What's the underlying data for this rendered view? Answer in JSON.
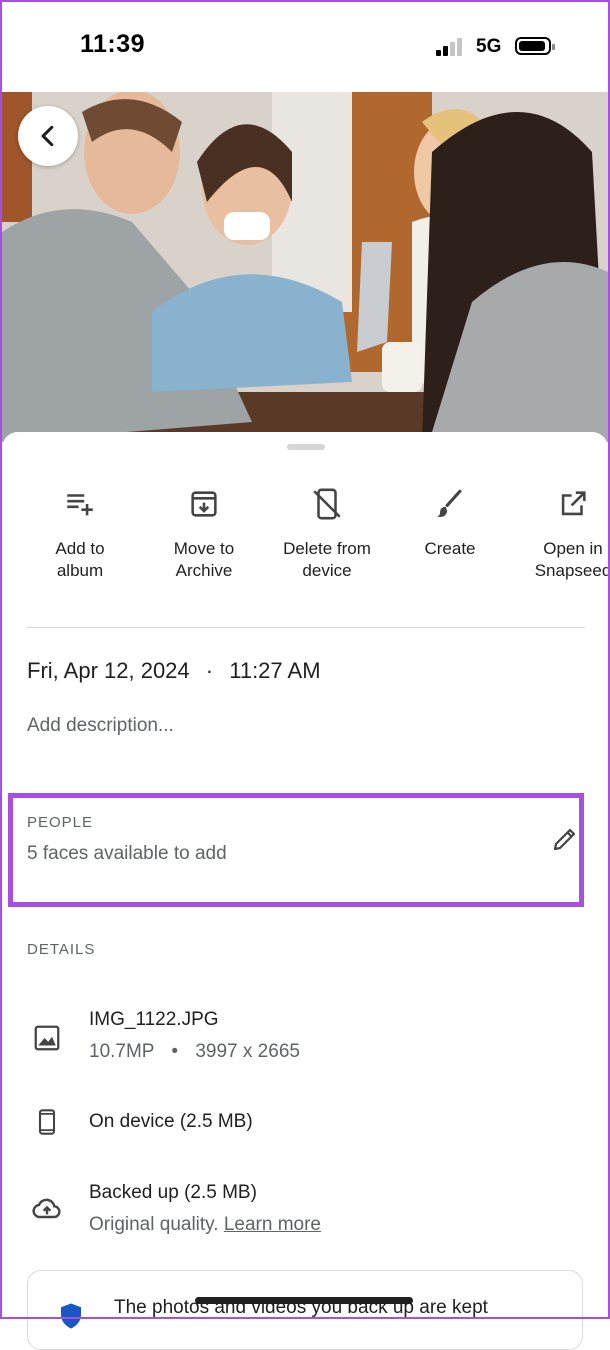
{
  "status_bar": {
    "time": "11:39",
    "network": "5G"
  },
  "actions": [
    {
      "label": "Add to\nalbum",
      "icon": "playlist-add-icon"
    },
    {
      "label": "Move to\nArchive",
      "icon": "archive-icon"
    },
    {
      "label": "Delete from\ndevice",
      "icon": "delete-from-device-icon"
    },
    {
      "label": "Create",
      "icon": "brush-icon"
    },
    {
      "label": "Open in\nSnapseed",
      "icon": "open-external-icon"
    }
  ],
  "info": {
    "date": "Fri, Apr 12, 2024",
    "separator": "·",
    "time": "11:27 AM",
    "description_placeholder": "Add description..."
  },
  "people": {
    "heading": "PEOPLE",
    "subtitle": "5 faces available to add",
    "highlight_color": "#a64fe0"
  },
  "details": {
    "heading": "DETAILS",
    "file": {
      "name": "IMG_1122.JPG",
      "megapixels": "10.7MP",
      "separator": "•",
      "resolution": "3997 x 2665"
    },
    "storage": {
      "title": "On device (2.5 MB)"
    },
    "backup": {
      "title": "Backed up (2.5 MB)",
      "quality": "Original quality.",
      "link": "Learn more"
    }
  },
  "card": {
    "text": "The photos and videos you back up are kept"
  }
}
